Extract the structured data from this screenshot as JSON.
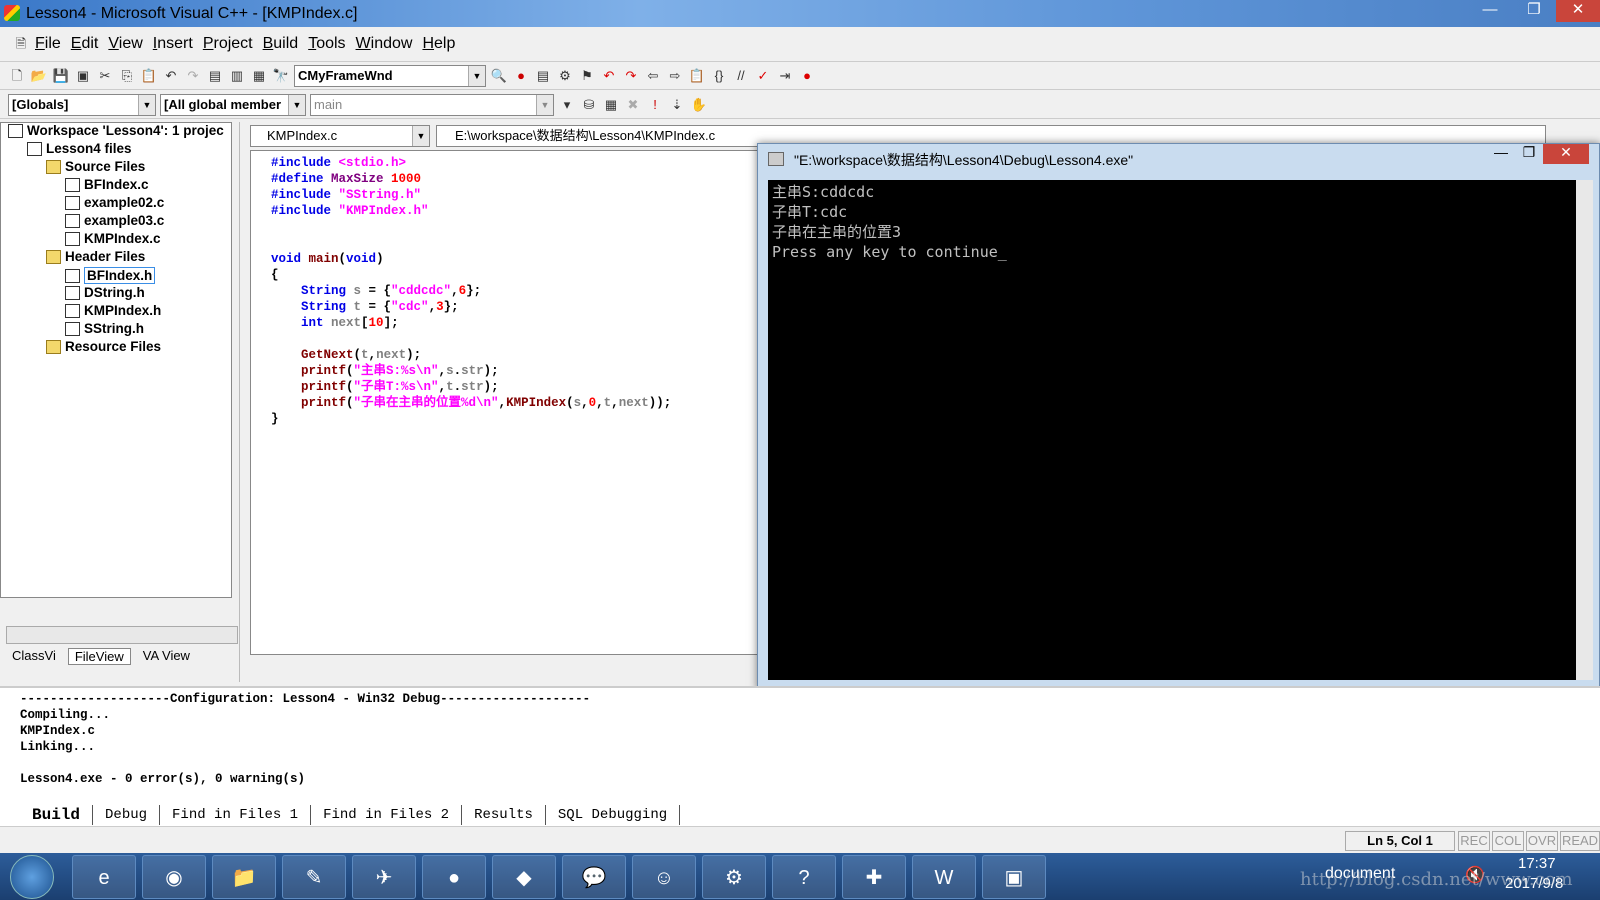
{
  "window": {
    "title": "Lesson4 - Microsoft Visual C++ - [KMPIndex.c]",
    "minimize": "—",
    "maximize": "❐",
    "close": "✕"
  },
  "menu": [
    "File",
    "Edit",
    "View",
    "Insert",
    "Project",
    "Build",
    "Tools",
    "Window",
    "Help"
  ],
  "toolbar": {
    "class_combo": "CMyFrameWnd",
    "globals_combo": "[Globals]",
    "members_combo": "[All global member",
    "function_combo": "main"
  },
  "workspace": {
    "items": [
      {
        "label": "Workspace 'Lesson4': 1 projec",
        "icon": "workspace-icon",
        "level": 0
      },
      {
        "label": "Lesson4 files",
        "icon": "project-icon",
        "level": 1
      },
      {
        "label": "Source Files",
        "icon": "folder-icon",
        "level": 2
      },
      {
        "label": "BFIndex.c",
        "icon": "file-icon",
        "level": 3
      },
      {
        "label": "example02.c",
        "icon": "file-icon",
        "level": 3
      },
      {
        "label": "example03.c",
        "icon": "file-icon",
        "level": 3
      },
      {
        "label": "KMPIndex.c",
        "icon": "file-icon",
        "level": 3
      },
      {
        "label": "Header Files",
        "icon": "folder-icon",
        "level": 2
      },
      {
        "label": "BFIndex.h",
        "icon": "header-icon",
        "level": 3,
        "selected": true
      },
      {
        "label": "DString.h",
        "icon": "header-icon",
        "level": 3
      },
      {
        "label": "KMPIndex.h",
        "icon": "header-icon",
        "level": 3
      },
      {
        "label": "SString.h",
        "icon": "header-icon",
        "level": 3
      },
      {
        "label": "Resource Files",
        "icon": "folder-icon",
        "level": 2
      }
    ],
    "tabs": [
      "ClassVi",
      "FileView",
      "VA View"
    ]
  },
  "editor": {
    "file_combo": "KMPIndex.c",
    "path": "E:\\workspace\\数据结构\\Lesson4\\KMPIndex.c",
    "lines": [
      [
        [
          "#include ",
          "kw"
        ],
        [
          "<stdio.h>",
          "str"
        ]
      ],
      [
        [
          "#define ",
          "kw"
        ],
        [
          "MaxSize ",
          "mac"
        ],
        [
          "1000",
          "num"
        ]
      ],
      [
        [
          "#include ",
          "kw"
        ],
        [
          "\"SString.h\"",
          "str"
        ]
      ],
      [
        [
          "#include ",
          "kw"
        ],
        [
          "\"KMPIndex.h\"",
          "str"
        ]
      ],
      [],
      [],
      [
        [
          "void ",
          "kw"
        ],
        [
          "main",
          "fn"
        ],
        [
          "(",
          "p"
        ],
        [
          "void",
          "kw"
        ],
        [
          ")",
          "p"
        ]
      ],
      [
        [
          "{",
          "p"
        ]
      ],
      [
        [
          "    String ",
          "kw"
        ],
        [
          "s",
          "id"
        ],
        [
          " = {",
          "p"
        ],
        [
          "\"cddcdc\"",
          "str"
        ],
        [
          ",",
          "p"
        ],
        [
          "6",
          "num"
        ],
        [
          "};",
          "p"
        ]
      ],
      [
        [
          "    String ",
          "kw"
        ],
        [
          "t",
          "id"
        ],
        [
          " = {",
          "p"
        ],
        [
          "\"cdc\"",
          "str"
        ],
        [
          ",",
          "p"
        ],
        [
          "3",
          "num"
        ],
        [
          "};",
          "p"
        ]
      ],
      [
        [
          "    int ",
          "kw"
        ],
        [
          "next",
          "id"
        ],
        [
          "[",
          "p"
        ],
        [
          "10",
          "num"
        ],
        [
          "];",
          "p"
        ]
      ],
      [],
      [
        [
          "    GetNext",
          "fn"
        ],
        [
          "(",
          "p"
        ],
        [
          "t",
          "id"
        ],
        [
          ",",
          "p"
        ],
        [
          "next",
          "id"
        ],
        [
          ");",
          "p"
        ]
      ],
      [
        [
          "    printf",
          "fn"
        ],
        [
          "(",
          "p"
        ],
        [
          "\"主串S:%s\\n\"",
          "str"
        ],
        [
          ",",
          "p"
        ],
        [
          "s",
          "id"
        ],
        [
          ".",
          "p"
        ],
        [
          "str",
          "id"
        ],
        [
          ");",
          "p"
        ]
      ],
      [
        [
          "    printf",
          "fn"
        ],
        [
          "(",
          "p"
        ],
        [
          "\"子串T:%s\\n\"",
          "str"
        ],
        [
          ",",
          "p"
        ],
        [
          "t",
          "id"
        ],
        [
          ".",
          "p"
        ],
        [
          "str",
          "id"
        ],
        [
          ");",
          "p"
        ]
      ],
      [
        [
          "    printf",
          "fn"
        ],
        [
          "(",
          "p"
        ],
        [
          "\"子串在主串的位置%d\\n\"",
          "str"
        ],
        [
          ",",
          "p"
        ],
        [
          "KMPIndex",
          "fn"
        ],
        [
          "(",
          "p"
        ],
        [
          "s",
          "id"
        ],
        [
          ",",
          "p"
        ],
        [
          "0",
          "num"
        ],
        [
          ",",
          "p"
        ],
        [
          "t",
          "id"
        ],
        [
          ",",
          "p"
        ],
        [
          "next",
          "id"
        ],
        [
          "));",
          "p"
        ]
      ],
      [
        [
          "}",
          "p"
        ]
      ]
    ]
  },
  "console": {
    "title": "\"E:\\workspace\\数据结构\\Lesson4\\Debug\\Lesson4.exe\"",
    "lines": [
      "主串S:cddcdc",
      "子串T:cdc",
      "子串在主串的位置3",
      "Press any key to continue"
    ]
  },
  "output": {
    "lines": [
      "--------------------Configuration: Lesson4 - Win32 Debug--------------------",
      "Compiling...",
      "KMPIndex.c",
      "Linking...",
      "",
      "Lesson4.exe - 0 error(s), 0 warning(s)"
    ],
    "tabs": [
      "Build",
      "Debug",
      "Find in Files 1",
      "Find in Files 2",
      "Results",
      "SQL Debugging"
    ],
    "active_tab": "Build"
  },
  "status": {
    "position": "Ln 5, Col 1",
    "indicators": [
      "REC",
      "COL",
      "OVR",
      "READ"
    ]
  },
  "taskbar": {
    "apps": [
      "internet-explorer",
      "chrome",
      "file-explorer",
      "notepad",
      "postman",
      "app-green",
      "feishu",
      "wechat",
      "avatar-app",
      "java-ee-ide",
      "help",
      "vc6",
      "word",
      "window-app"
    ],
    "tray_label": "document",
    "time": "17:37",
    "date": "2017/9/8"
  },
  "watermark": "http://blog.csdn.net/www.com"
}
